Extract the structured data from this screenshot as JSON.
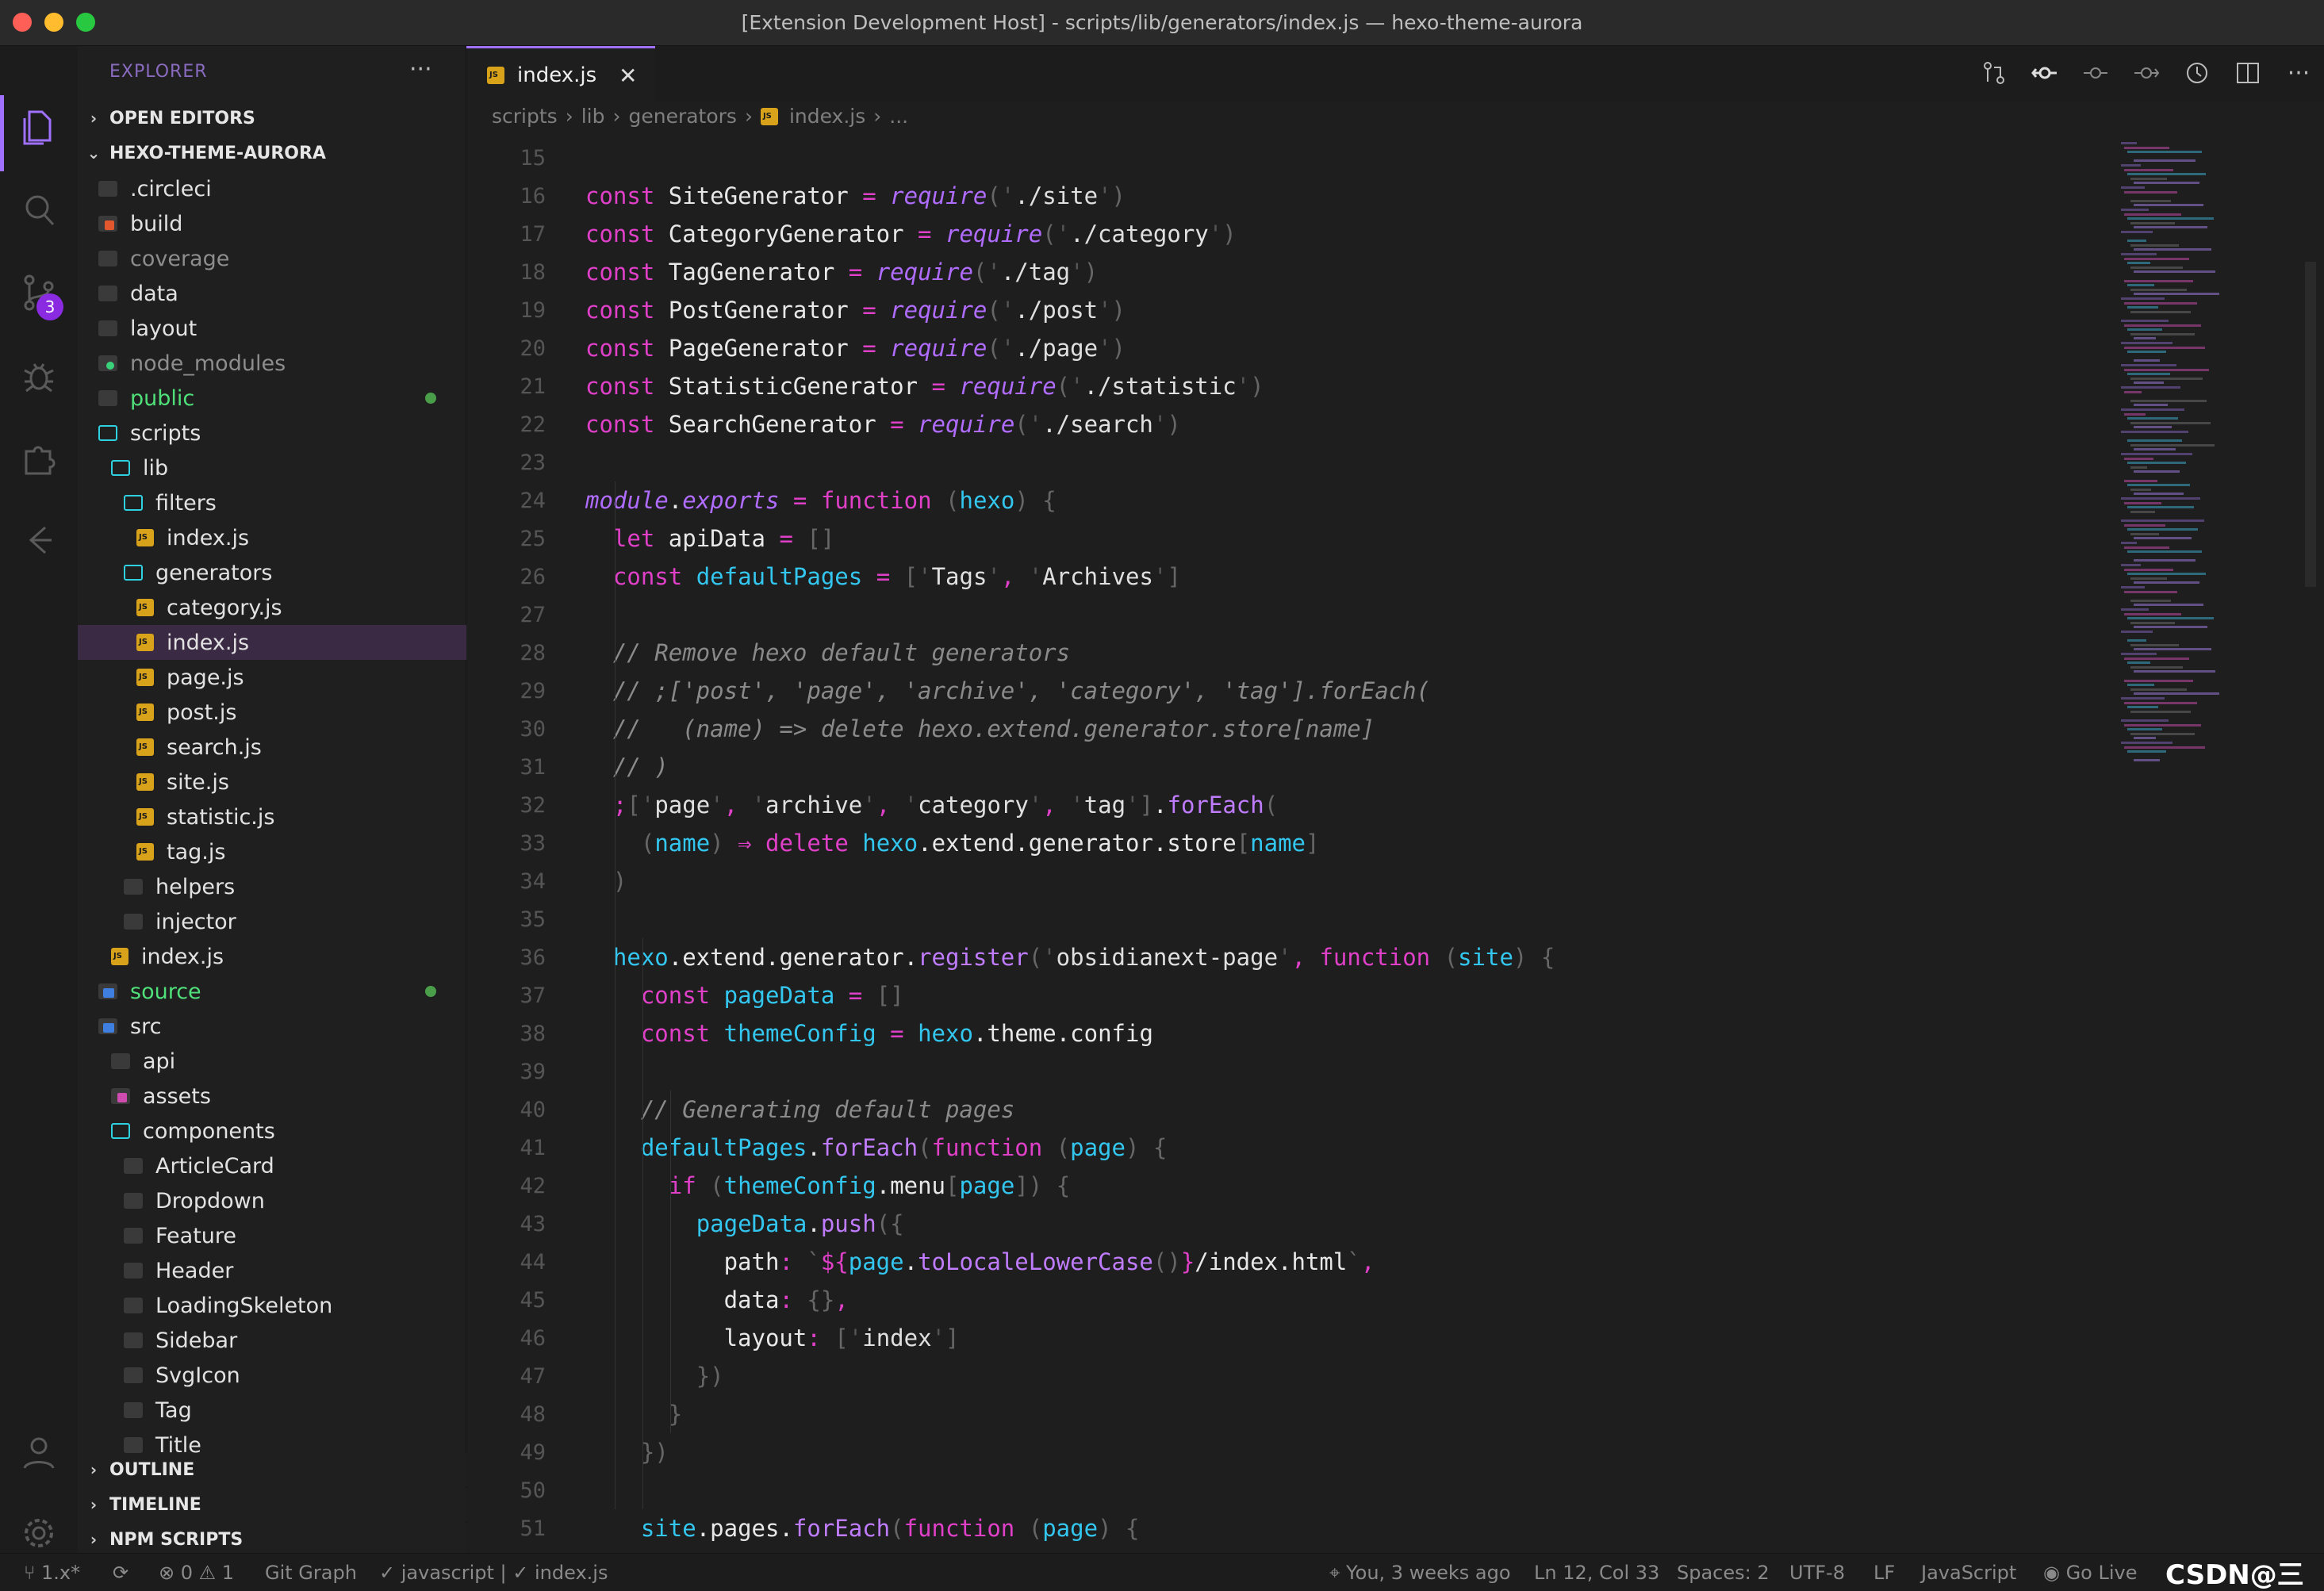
{
  "window": {
    "title": "[Extension Development Host] - scripts/lib/generators/index.js — hexo-theme-aurora"
  },
  "activity_bar": {
    "scm_badge": "3"
  },
  "explorer": {
    "header": "EXPLORER",
    "more": "···",
    "sections": {
      "open_editors": "OPEN EDITORS",
      "project": "HEXO-THEME-AURORA",
      "outline": "OUTLINE",
      "timeline": "TIMELINE",
      "npm_scripts": "NPM SCRIPTS"
    },
    "tree": [
      {
        "label": ".circleci"
      },
      {
        "label": "build"
      },
      {
        "label": "coverage"
      },
      {
        "label": "data"
      },
      {
        "label": "layout"
      },
      {
        "label": "node_modules"
      },
      {
        "label": "public"
      },
      {
        "label": "scripts"
      },
      {
        "label": "lib"
      },
      {
        "label": "filters"
      },
      {
        "label": "index.js"
      },
      {
        "label": "generators"
      },
      {
        "label": "category.js"
      },
      {
        "label": "index.js"
      },
      {
        "label": "page.js"
      },
      {
        "label": "post.js"
      },
      {
        "label": "search.js"
      },
      {
        "label": "site.js"
      },
      {
        "label": "statistic.js"
      },
      {
        "label": "tag.js"
      },
      {
        "label": "helpers"
      },
      {
        "label": "injector"
      },
      {
        "label": "index.js"
      },
      {
        "label": "source"
      },
      {
        "label": "src"
      },
      {
        "label": "api"
      },
      {
        "label": "assets"
      },
      {
        "label": "components"
      },
      {
        "label": "ArticleCard"
      },
      {
        "label": "Dropdown"
      },
      {
        "label": "Feature"
      },
      {
        "label": "Header"
      },
      {
        "label": "LoadingSkeleton"
      },
      {
        "label": "Sidebar"
      },
      {
        "label": "SvgIcon"
      },
      {
        "label": "Tag"
      },
      {
        "label": "Title"
      }
    ]
  },
  "tab": {
    "label": "index.js",
    "close": "✕"
  },
  "breadcrumb": [
    "scripts",
    "lib",
    "generators",
    "index.js",
    "..."
  ],
  "editor": {
    "lines": [
      {
        "n": "15",
        "t": ""
      },
      {
        "n": "16",
        "t": "const SiteGenerator = require('./site')"
      },
      {
        "n": "17",
        "t": "const CategoryGenerator = require('./category')"
      },
      {
        "n": "18",
        "t": "const TagGenerator = require('./tag')"
      },
      {
        "n": "19",
        "t": "const PostGenerator = require('./post')"
      },
      {
        "n": "20",
        "t": "const PageGenerator = require('./page')"
      },
      {
        "n": "21",
        "t": "const StatisticGenerator = require('./statistic')"
      },
      {
        "n": "22",
        "t": "const SearchGenerator = require('./search')"
      },
      {
        "n": "23",
        "t": ""
      },
      {
        "n": "24",
        "t": "module.exports = function (hexo) {"
      },
      {
        "n": "25",
        "t": "  let apiData = []"
      },
      {
        "n": "26",
        "t": "  const defaultPages = ['Tags', 'Archives']"
      },
      {
        "n": "27",
        "t": ""
      },
      {
        "n": "28",
        "t": "  // Remove hexo default generators"
      },
      {
        "n": "29",
        "t": "  // ;['post', 'page', 'archive', 'category', 'tag'].forEach("
      },
      {
        "n": "30",
        "t": "  //   (name) => delete hexo.extend.generator.store[name]"
      },
      {
        "n": "31",
        "t": "  // )"
      },
      {
        "n": "32",
        "t": "  ;['page', 'archive', 'category', 'tag'].forEach("
      },
      {
        "n": "33",
        "t": "    (name) => delete hexo.extend.generator.store[name]"
      },
      {
        "n": "34",
        "t": "  )"
      },
      {
        "n": "35",
        "t": ""
      },
      {
        "n": "36",
        "t": "  hexo.extend.generator.register('obsidianext-page', function (site) {"
      },
      {
        "n": "37",
        "t": "    const pageData = []"
      },
      {
        "n": "38",
        "t": "    const themeConfig = hexo.theme.config"
      },
      {
        "n": "39",
        "t": ""
      },
      {
        "n": "40",
        "t": "    // Generating default pages"
      },
      {
        "n": "41",
        "t": "    defaultPages.forEach(function (page) {"
      },
      {
        "n": "42",
        "t": "      if (themeConfig.menu[page]) {"
      },
      {
        "n": "43",
        "t": "        pageData.push({"
      },
      {
        "n": "44",
        "t": "          path: `${page.toLocaleLowerCase()}/index.html`,"
      },
      {
        "n": "45",
        "t": "          data: {},"
      },
      {
        "n": "46",
        "t": "          layout: ['index']"
      },
      {
        "n": "47",
        "t": "        })"
      },
      {
        "n": "48",
        "t": "      }"
      },
      {
        "n": "49",
        "t": "    })"
      },
      {
        "n": "50",
        "t": ""
      },
      {
        "n": "51",
        "t": "    site.pages.forEach(function (page) {"
      }
    ]
  },
  "status": {
    "branch": "1.x*",
    "sync": "⟳",
    "problems": "⊗ 0 ⚠ 1",
    "git_graph": "Git Graph",
    "lang_check": "✓ javascript | ✓ index.js",
    "blame": "You, 3 weeks ago",
    "cursor": "Ln 12, Col 33",
    "spaces": "Spaces: 2",
    "encoding": "UTF-8",
    "eol": "LF",
    "language": "JavaScript",
    "golive": "Go Live",
    "watermark": "CSDN@三钻"
  },
  "colors": {
    "accent": "#a070ff",
    "keyword": "#e040c8",
    "variable": "#33c7f0",
    "function": "#c07cff"
  }
}
